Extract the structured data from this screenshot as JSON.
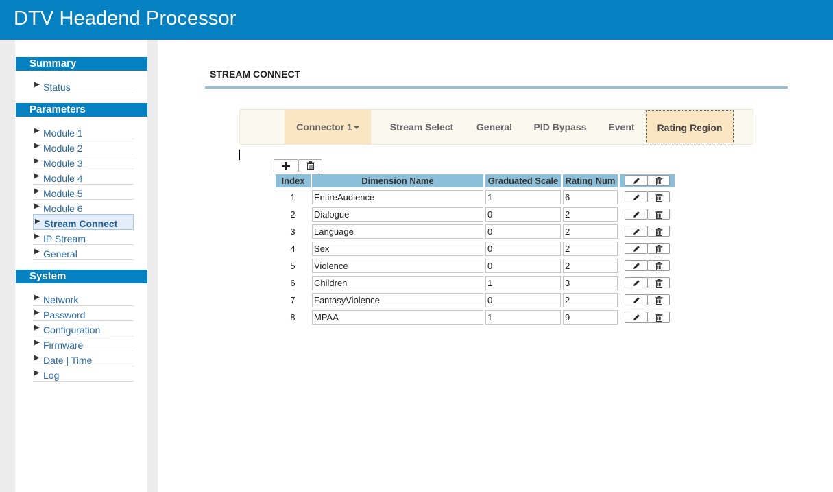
{
  "app": {
    "title": "DTV Headend Processor"
  },
  "sidebar": {
    "sections": [
      {
        "title": "Summary",
        "items": [
          "Status"
        ]
      },
      {
        "title": "Parameters",
        "items": [
          "Module 1",
          "Module 2",
          "Module 3",
          "Module 4",
          "Module 5",
          "Module 6",
          "Stream Connect",
          "IP Stream",
          "General"
        ]
      },
      {
        "title": "System",
        "items": [
          "Network",
          "Password",
          "Configuration",
          "Firmware",
          "Date | Time",
          "Log"
        ]
      }
    ],
    "active_item": "Stream Connect"
  },
  "page": {
    "title": "STREAM CONNECT"
  },
  "tabs": {
    "connector": "Connector 1",
    "items": [
      "Stream Select",
      "General",
      "PID Bypass",
      "Event",
      "Rating Region"
    ],
    "active": "Rating Region"
  },
  "icons": {
    "add": "plus-icon",
    "delete": "trash-icon",
    "edit": "pencil-icon"
  },
  "table": {
    "headers": [
      "Index",
      "Dimension Name",
      "Graduated Scale",
      "Rating Num"
    ],
    "rows": [
      {
        "index": "1",
        "name": "EntireAudience",
        "scale": "1",
        "num": "6"
      },
      {
        "index": "2",
        "name": "Dialogue",
        "scale": "0",
        "num": "2"
      },
      {
        "index": "3",
        "name": "Language",
        "scale": "0",
        "num": "2"
      },
      {
        "index": "4",
        "name": "Sex",
        "scale": "0",
        "num": "2"
      },
      {
        "index": "5",
        "name": "Violence",
        "scale": "0",
        "num": "2"
      },
      {
        "index": "6",
        "name": "Children",
        "scale": "1",
        "num": "3"
      },
      {
        "index": "7",
        "name": "FantasyViolence",
        "scale": "0",
        "num": "2"
      },
      {
        "index": "8",
        "name": "MPAA",
        "scale": "1",
        "num": "9"
      }
    ]
  },
  "colors": {
    "header": "#0580c0",
    "table_header": "#8cc0da",
    "tab_active": "#fbe6c4",
    "link": "#2a6aa3"
  }
}
